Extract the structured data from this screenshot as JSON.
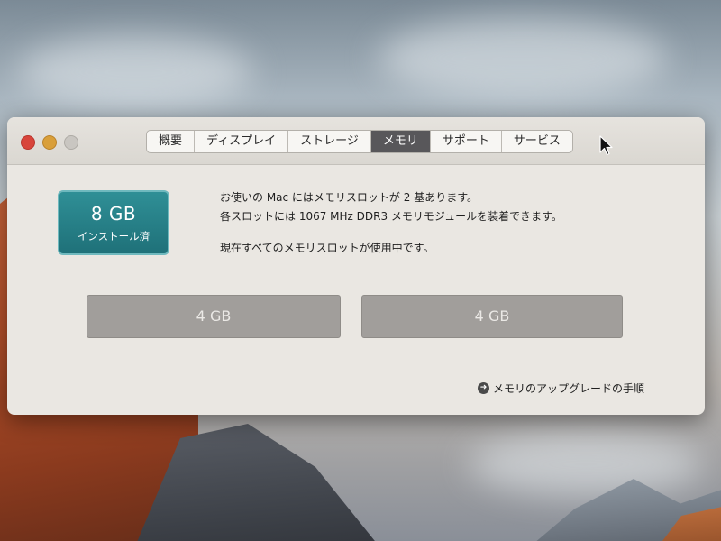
{
  "window": {
    "tabs": [
      {
        "label": "概要",
        "active": false
      },
      {
        "label": "ディスプレイ",
        "active": false
      },
      {
        "label": "ストレージ",
        "active": false
      },
      {
        "label": "メモリ",
        "active": true
      },
      {
        "label": "サポート",
        "active": false
      },
      {
        "label": "サービス",
        "active": false
      }
    ]
  },
  "memory": {
    "installed_size": "8 GB",
    "installed_label": "インストール済",
    "info_line1": "お使いの Mac にはメモリスロットが 2 基あります。",
    "info_line2": "各スロットには 1067 MHz DDR3 メモリモジュールを装着できます。",
    "info_line3": "現在すべてのメモリスロットが使用中です。",
    "slots": [
      {
        "label": "4 GB"
      },
      {
        "label": "4 GB"
      }
    ],
    "upgrade_link": "メモリのアップグレードの手順"
  },
  "icons": {
    "traffic_close": "close-button-icon",
    "traffic_minimize": "minimize-button-icon",
    "traffic_zoom": "zoom-button-icon",
    "upgrade_arrow": "arrow-right-circle-icon",
    "cursor": "pointer-cursor-icon"
  },
  "colors": {
    "badge_bg": "#1f7179",
    "active_tab_bg": "#58575a",
    "slot_bg": "#a19e9b",
    "traffic_close": "#d8453b",
    "traffic_minimize": "#d99f3a"
  }
}
